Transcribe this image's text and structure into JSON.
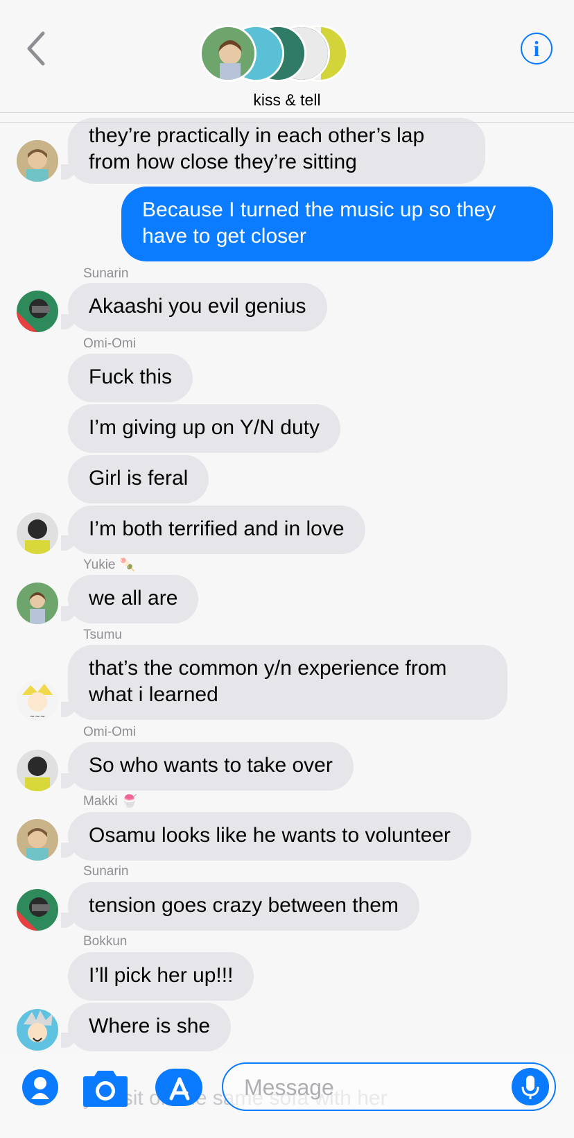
{
  "header": {
    "title": "kiss & tell",
    "back_icon": "chevron-left-icon",
    "info_label": "i"
  },
  "messages": [
    {
      "kind": "in",
      "sender": "",
      "text": "they’re practically in each other’s lap from how close they’re sitting"
    },
    {
      "kind": "out",
      "text": "Because I turned the music up so they have to get closer"
    },
    {
      "kind": "in",
      "sender": "Sunarin",
      "text": "Akaashi you evil genius"
    },
    {
      "kind": "in",
      "sender": "Omi-Omi",
      "text": "Fuck this"
    },
    {
      "kind": "in",
      "text": "I’m giving up on Y/N duty"
    },
    {
      "kind": "in",
      "text": "Girl is feral"
    },
    {
      "kind": "in",
      "text": "I’m both terrified and in love"
    },
    {
      "kind": "in",
      "sender": "Yukie",
      "sender_emoji": "🍡",
      "text": "we all are"
    },
    {
      "kind": "in",
      "sender": "Tsumu",
      "text": "that’s the common y/n experience from what i learned"
    },
    {
      "kind": "in",
      "sender": "Omi-Omi",
      "text": "So who wants to take over"
    },
    {
      "kind": "in",
      "sender": "Makki",
      "sender_emoji": "🍧",
      "text": "Osamu looks like he wants to volunteer"
    },
    {
      "kind": "in",
      "sender": "Sunarin",
      "text": "tension goes crazy between them"
    },
    {
      "kind": "in",
      "sender": "Bokkun",
      "text": "I’ll pick her up!!!"
    },
    {
      "kind": "in",
      "text": "Where is she"
    }
  ],
  "ghost_text": "you sit on the same sofa with her",
  "composer": {
    "placeholder": "Message"
  },
  "colors": {
    "accent": "#0a7aff",
    "incoming_bubble": "#e5e5ea",
    "outgoing_bubble": "#0b7cff",
    "background": "#f7f7f8"
  }
}
